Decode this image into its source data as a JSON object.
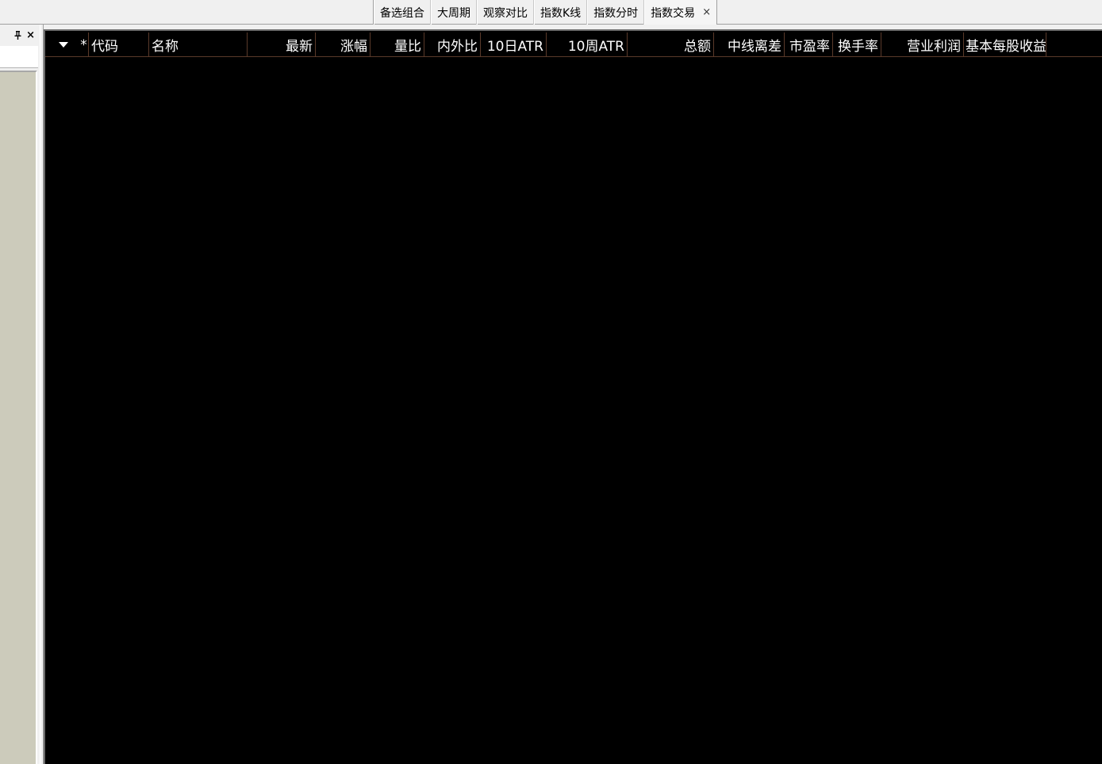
{
  "tabs": [
    {
      "label": "备选组合",
      "active": false
    },
    {
      "label": "大周期",
      "active": false
    },
    {
      "label": "观察对比",
      "active": false
    },
    {
      "label": "指数K线",
      "active": false
    },
    {
      "label": "指数分时",
      "active": false
    },
    {
      "label": "指数交易",
      "active": true
    }
  ],
  "tab_close_glyph": "×",
  "left_panel": {
    "pin_glyph": "ᵖ",
    "close_glyph": "×"
  },
  "grid": {
    "sort_icon": "chevron-down-icon",
    "columns": [
      {
        "label": "*"
      },
      {
        "label": "代码"
      },
      {
        "label": "名称"
      },
      {
        "label": "最新"
      },
      {
        "label": "涨幅"
      },
      {
        "label": "量比"
      },
      {
        "label": "内外比"
      },
      {
        "label": "10日ATR"
      },
      {
        "label": "10周ATR"
      },
      {
        "label": "总额"
      },
      {
        "label": "中线离差"
      },
      {
        "label": "市盈率"
      },
      {
        "label": "换手率"
      },
      {
        "label": "营业利润"
      },
      {
        "label": "基本每股收益"
      }
    ],
    "rows": []
  },
  "colors": {
    "grid_background": "#000000",
    "header_text": "#ffffff",
    "grid_line": "#5a3a2a",
    "panel_background": "#cccbbb",
    "chrome_background": "#f0f0f0"
  }
}
